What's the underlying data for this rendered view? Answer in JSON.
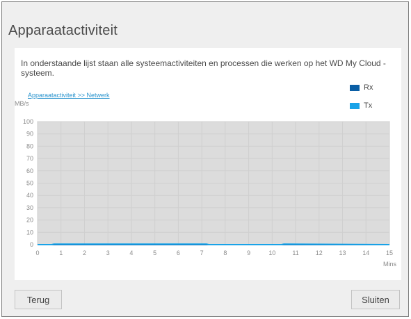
{
  "dialog": {
    "title": "Apparaatactiviteit",
    "description": "In onderstaande lijst staan alle systeemactiviteiten en processen die werken op het WD My Cloud -systeem.",
    "breadcrumb": "Apparaatactiviteit >> Netwerk",
    "back_label": "Terug",
    "close_label": "Sluiten"
  },
  "colors": {
    "rx": "#0a5ea5",
    "tx": "#1aa3e8",
    "plot_bg": "#dcdcdc"
  },
  "chart_data": {
    "type": "line",
    "ylabel": "MB/s",
    "xlabel": "Mins",
    "ylim": [
      0,
      100
    ],
    "xlim": [
      0,
      15
    ],
    "yticks": [
      100,
      90,
      80,
      70,
      60,
      50,
      40,
      30,
      20,
      10,
      0
    ],
    "xticks": [
      0,
      1,
      2,
      3,
      4,
      5,
      6,
      7,
      8,
      9,
      10,
      11,
      12,
      13,
      14,
      15
    ],
    "grid": true,
    "legend": "top-right",
    "series": [
      {
        "name": "Rx",
        "x": [
          0,
          15
        ],
        "y": [
          0,
          0
        ]
      },
      {
        "name": "Tx",
        "x": [
          0,
          0.6,
          0.7,
          7.2,
          7.3,
          10.4,
          10.5,
          15
        ],
        "y": [
          0,
          0,
          0.4,
          0.4,
          0,
          0,
          0.4,
          0
        ]
      }
    ]
  }
}
